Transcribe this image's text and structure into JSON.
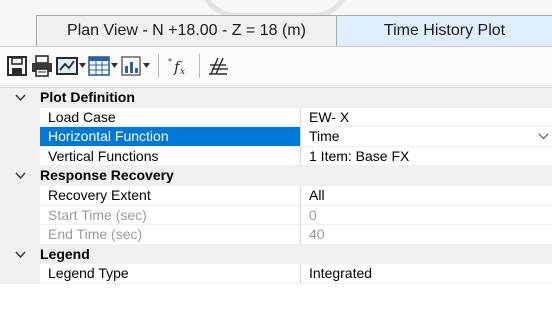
{
  "tabs": [
    {
      "label": "Plan View - N +18.00 - Z = 18 (m)",
      "active": false
    },
    {
      "label": "Time History Plot",
      "active": true
    }
  ],
  "toolbar": {
    "icons": [
      "save-icon",
      "print-icon",
      "view-icon",
      "table-icon",
      "chart-icon",
      "function-icon",
      "axis-icon"
    ]
  },
  "categories": {
    "plot_definition": {
      "label": "Plot Definition",
      "props": [
        {
          "name": "Load Case",
          "value": "EW- X"
        },
        {
          "name": "Horizontal Function",
          "value": "Time"
        },
        {
          "name": "Vertical Functions",
          "value": "1 Item: Base FX"
        }
      ]
    },
    "response_recovery": {
      "label": "Response Recovery",
      "props": [
        {
          "name": "Recovery Extent",
          "value": "All"
        },
        {
          "name": "Start Time (sec)",
          "value": "0"
        },
        {
          "name": "End Time (sec)",
          "value": "40"
        }
      ]
    },
    "legend": {
      "label": "Legend",
      "props": [
        {
          "name": "Legend Type",
          "value": "Integrated"
        }
      ]
    }
  },
  "colors": {
    "selection": "#0078d7",
    "active_tab": "#dfeefc",
    "disabled_text": "#9a9a9a"
  }
}
